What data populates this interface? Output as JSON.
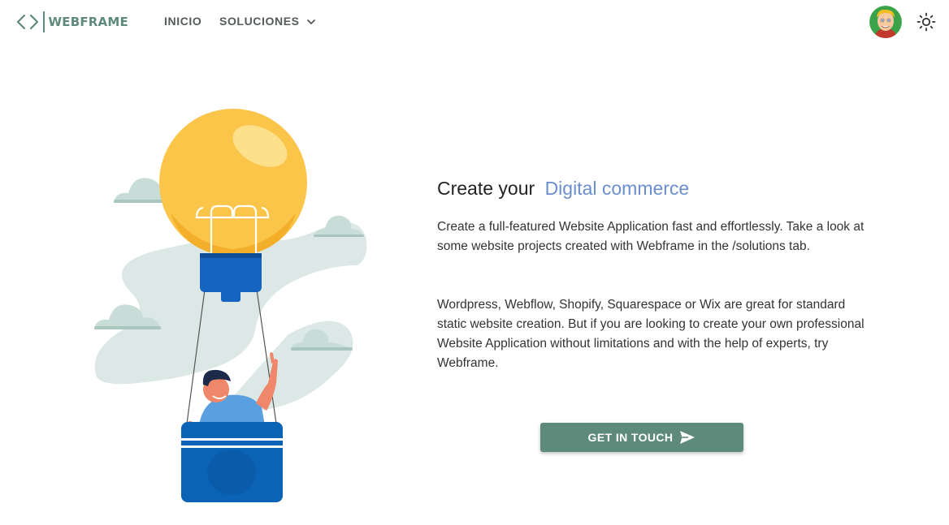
{
  "header": {
    "brand": "WEBFRAME",
    "nav": [
      {
        "label": "INICIO"
      },
      {
        "label": "SOLUCIONES"
      }
    ],
    "icons": {
      "logo": "code-brackets-icon",
      "dropdown": "chevron-down-icon",
      "avatar": "user-avatar",
      "theme": "sun-icon"
    }
  },
  "hero": {
    "title_prefix": "Create your",
    "title_accent": "Digital commerce",
    "paragraph1": "Create a full-featured Website Application fast and effortlessly. Take a look at some website projects created with Webframe in the /solutions tab.",
    "paragraph2": "Wordpress, Webflow, Shopify, Squarespace or Wix are great for standard static website creation. But if you are looking to create your own professional Website Application without limitations and with the help of experts, try Webframe.",
    "cta_label": "GET IN TOUCH",
    "cta_icon": "send-icon"
  },
  "colors": {
    "brand": "#5e8a7b",
    "accent": "#6b8ecf",
    "balloon": "#fbc54a",
    "basket": "#0b63b5",
    "cloud": "#c9ddd8"
  }
}
